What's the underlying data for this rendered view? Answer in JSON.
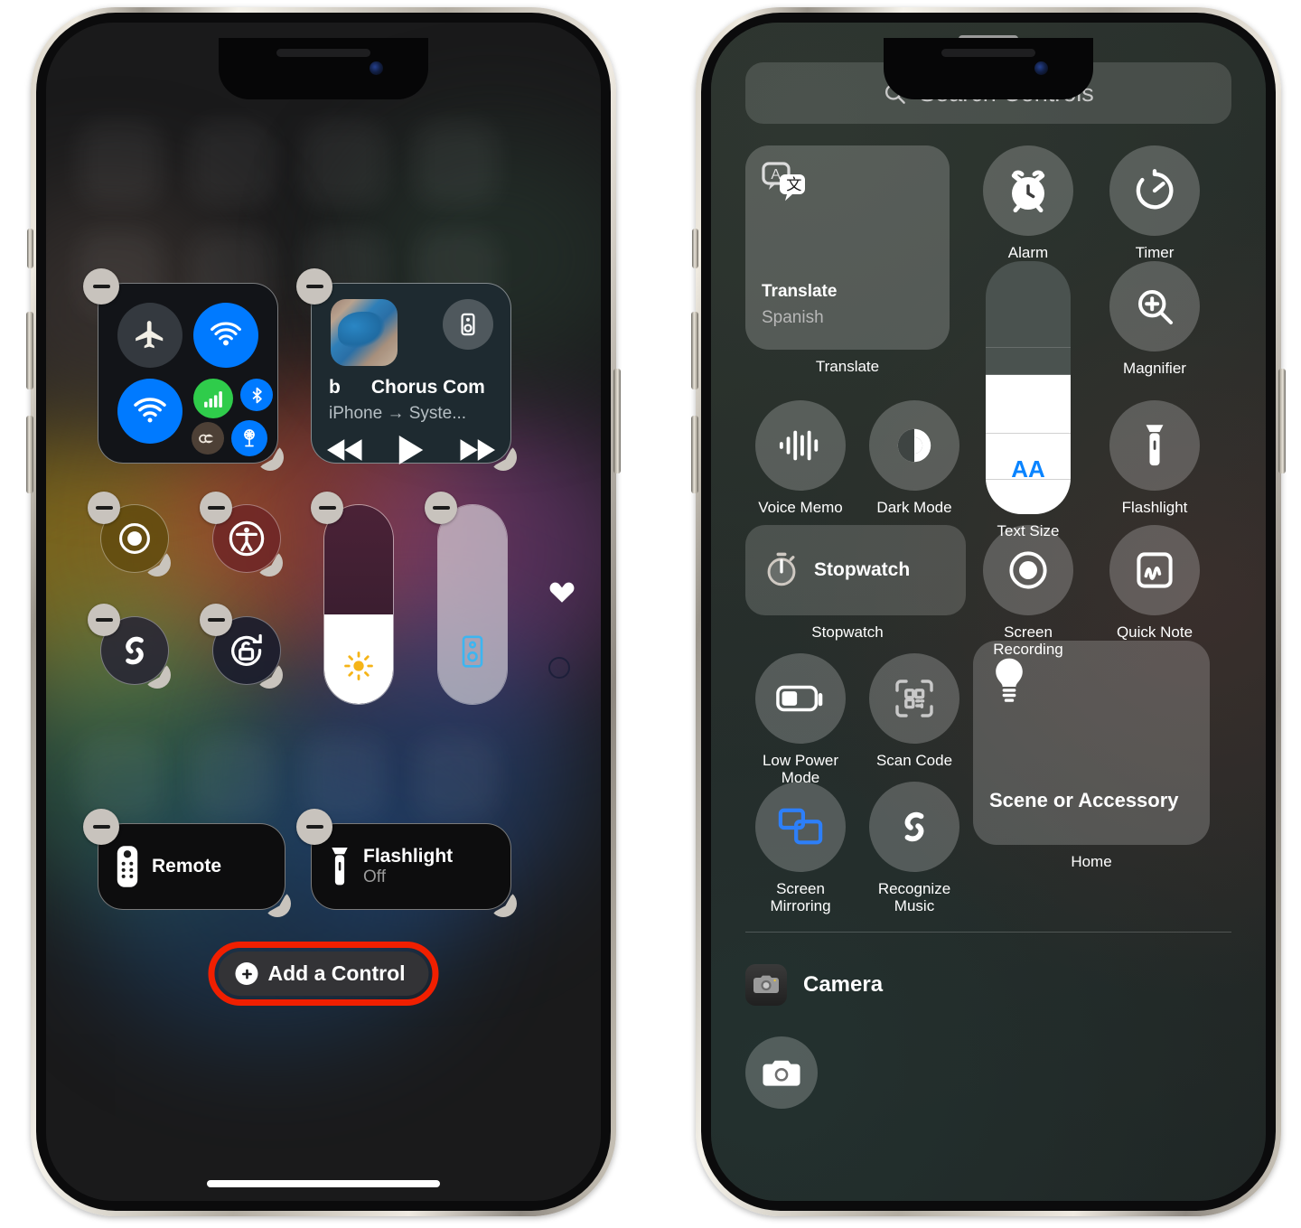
{
  "left_phone": {
    "label": "iPhone Control Center edit mode",
    "modules": {
      "connectivity": {
        "name": "Connectivity",
        "items": [
          "Airplane Mode",
          "AirDrop",
          "Wi-Fi",
          "Cellular Data",
          "Bluetooth",
          "VPN",
          "Satellite"
        ]
      },
      "now_playing": {
        "lead_char": "b",
        "title": "Chorus Com",
        "route": "iPhone → Syste...",
        "buttons": [
          "rewind",
          "play",
          "fast-forward"
        ],
        "airplay_label": "AirPlay"
      },
      "round_controls": [
        {
          "name": "Screen Recording",
          "icon": "screen-record-icon"
        },
        {
          "name": "Accessibility Shortcuts",
          "icon": "accessibility-icon"
        },
        {
          "name": "Recognize Music",
          "icon": "shazam-icon"
        },
        {
          "name": "Rotation Lock",
          "icon": "rotation-lock-icon"
        }
      ],
      "sliders": [
        {
          "name": "Brightness",
          "icon": "sun-icon",
          "fill_percent": 45
        },
        {
          "name": "Volume",
          "icon": "speaker-icon",
          "fill_percent": 100
        }
      ],
      "markers": [
        {
          "name": "Favorite",
          "icon": "heart-icon"
        },
        {
          "name": "Page Dot",
          "icon": "circle-outline-icon"
        }
      ],
      "pills": [
        {
          "label": "Remote",
          "sub": "",
          "icon": "remote-icon"
        },
        {
          "label": "Flashlight",
          "sub": "Off",
          "icon": "flashlight-icon"
        }
      ]
    },
    "add_control": {
      "label": "Add a Control",
      "icon": "plus-circle-icon",
      "highlight_color": "#f01f00"
    }
  },
  "right_phone": {
    "label": "Controls Gallery",
    "search": {
      "placeholder": "Search Controls",
      "icon": "search-icon"
    },
    "gallery": [
      {
        "id": "translate",
        "type": "big-tile",
        "title": "Translate",
        "subtitle": "Spanish",
        "caption": "Translate",
        "icon": "translate-icon"
      },
      {
        "id": "alarm",
        "type": "circle",
        "caption": "Alarm",
        "icon": "alarm-clock-icon"
      },
      {
        "id": "timer",
        "type": "circle",
        "caption": "Timer",
        "icon": "timer-icon"
      },
      {
        "id": "voice-memo",
        "type": "circle",
        "caption": "Voice Memo",
        "icon": "waveform-icon"
      },
      {
        "id": "dark-mode",
        "type": "circle",
        "caption": "Dark Mode",
        "icon": "dark-mode-icon"
      },
      {
        "id": "text-size",
        "type": "slider",
        "caption": "Text Size",
        "icon": "aa-icon",
        "glyph": "AA"
      },
      {
        "id": "magnifier",
        "type": "circle",
        "caption": "Magnifier",
        "icon": "magnifier-icon"
      },
      {
        "id": "flashlight",
        "type": "circle",
        "caption": "Flashlight",
        "icon": "flashlight-icon"
      },
      {
        "id": "stopwatch",
        "type": "wide-tile",
        "title": "Stopwatch",
        "caption": "Stopwatch",
        "icon": "stopwatch-icon"
      },
      {
        "id": "screen-recording",
        "type": "circle",
        "caption": "Screen Recording",
        "icon": "screen-record-icon"
      },
      {
        "id": "quick-note",
        "type": "circle",
        "caption": "Quick Note",
        "icon": "quick-note-icon"
      },
      {
        "id": "low-power-mode",
        "type": "circle",
        "caption": "Low Power Mode",
        "icon": "battery-icon"
      },
      {
        "id": "scan-code",
        "type": "circle",
        "caption": "Scan Code",
        "icon": "qr-scan-icon"
      },
      {
        "id": "scene-or-accessory",
        "type": "big-tile",
        "title": "Scene or Accessory",
        "caption": "Home",
        "icon": "lightbulb-icon"
      },
      {
        "id": "screen-mirroring",
        "type": "circle",
        "caption": "Screen Mirroring",
        "icon": "screen-mirroring-icon"
      },
      {
        "id": "recognize-music",
        "type": "circle",
        "caption": "Recognize Music",
        "icon": "shazam-icon"
      }
    ],
    "app_section": [
      {
        "id": "camera",
        "name": "Camera",
        "icon": "camera-app-icon",
        "control_icon": "camera-icon"
      }
    ]
  },
  "colors": {
    "accent_blue": "#007aff",
    "green": "#2fcc4b",
    "highlight_red": "#f01f00",
    "text_blue": "#0a84ff"
  }
}
